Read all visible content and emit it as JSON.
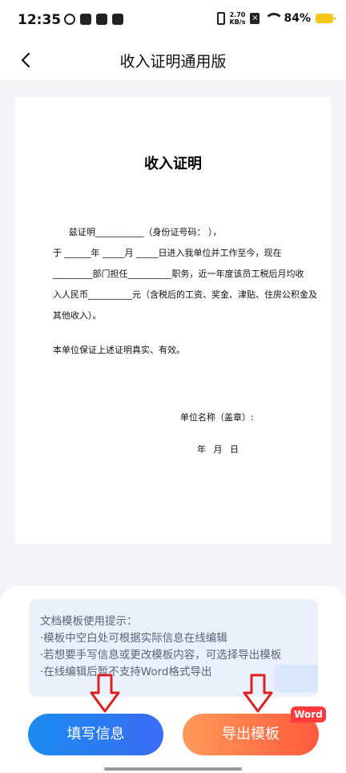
{
  "status_bar": {
    "time": "12:35",
    "net_speed_value": "2.70",
    "net_speed_unit": "KB/s",
    "battery_percent": "84%"
  },
  "header": {
    "title": "收入证明通用版"
  },
  "document": {
    "title": "收入证明",
    "lines": [
      "兹证明___________（身份证号码：                              ），",
      "于 ______年 _____月 _____日进入我单位并工作至今，现在",
      "_________部门担任__________职务，近一年度该员工税后月均收",
      "入人民币__________元（含税后的工资、奖金、津贴、住房公积金及",
      "其他收入）。",
      "本单位保证上述证明真实、有效。"
    ],
    "signature": "单位名称（盖章）:",
    "date": "年 月 日"
  },
  "tips": {
    "title": "文档模板使用提示：",
    "items": [
      "·模板中空白处可根据实际信息在线编辑",
      "·若想要手写信息或更改模板内容，可选择导出模板",
      "·在线编辑后暂不支持Word格式导出"
    ]
  },
  "buttons": {
    "fill_label": "填写信息",
    "export_label": "导出模板",
    "word_badge": "Word"
  },
  "colors": {
    "fill_button": "#1a8cf0",
    "export_button": "#ff5a3c",
    "arrow": "#e02020"
  }
}
